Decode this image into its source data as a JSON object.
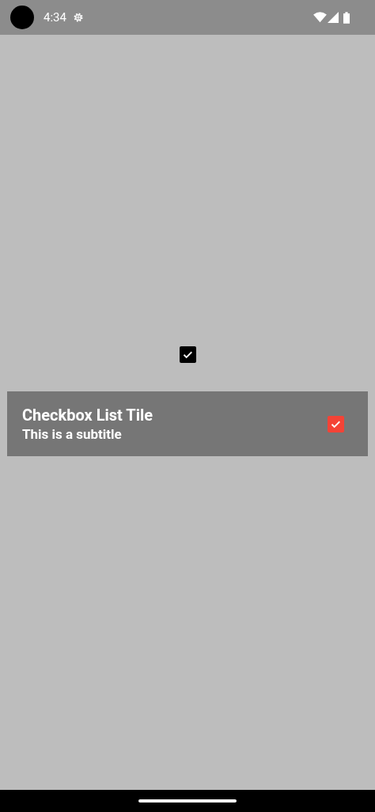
{
  "status_bar": {
    "time": "4:34"
  },
  "checkbox": {
    "checked": true
  },
  "list_tile": {
    "title": "Checkbox List Tile",
    "subtitle": "This is a subtitle",
    "checked": true
  }
}
